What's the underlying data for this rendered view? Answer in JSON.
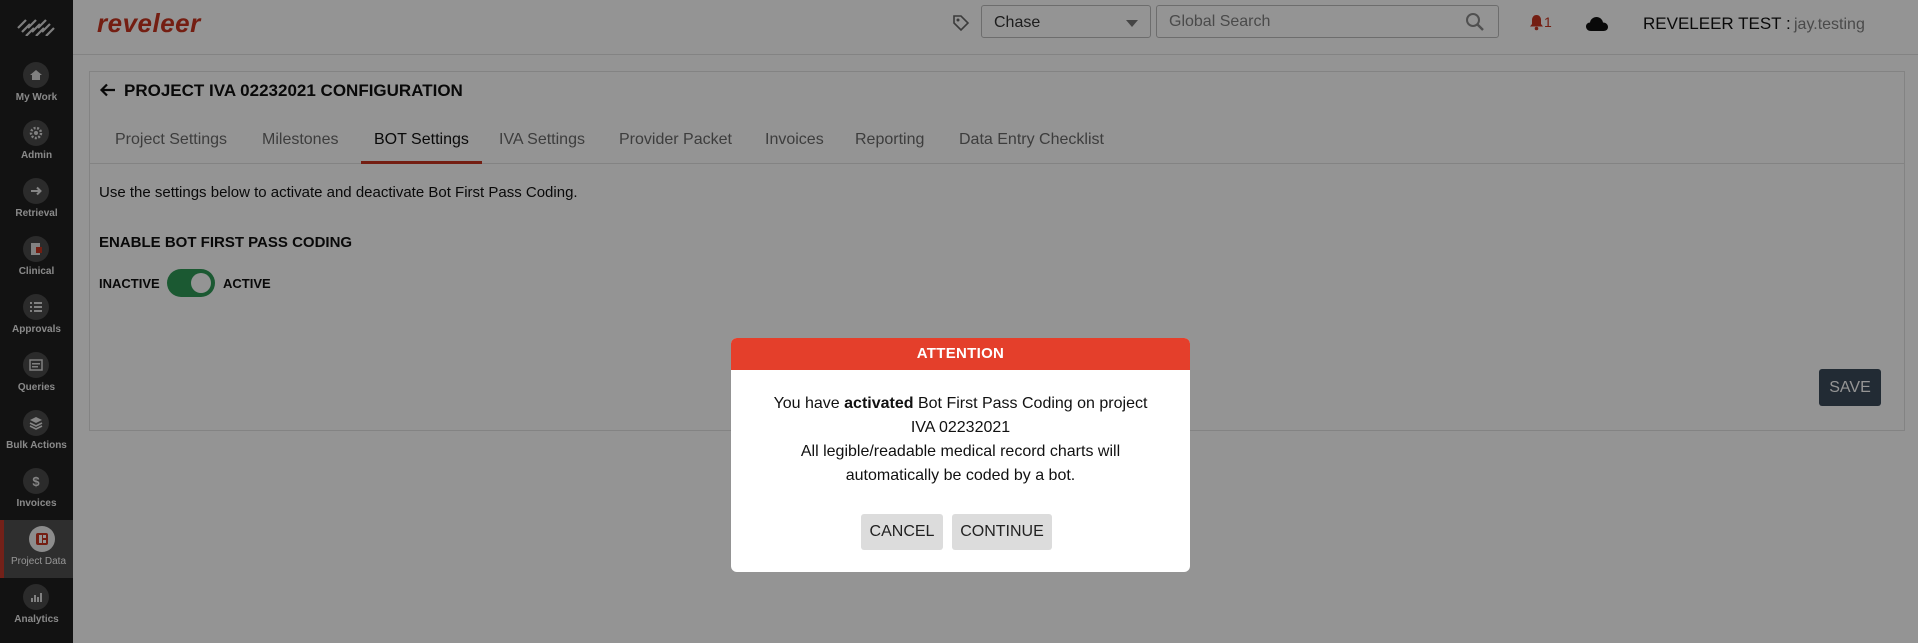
{
  "sidebar": {
    "items": [
      {
        "label": "My Work",
        "icon": "home-icon"
      },
      {
        "label": "Admin",
        "icon": "gear-icon"
      },
      {
        "label": "Retrieval",
        "icon": "arrow-right-icon"
      },
      {
        "label": "Clinical",
        "icon": "document-icon"
      },
      {
        "label": "Approvals",
        "icon": "checklist-icon"
      },
      {
        "label": "Queries",
        "icon": "queries-icon"
      },
      {
        "label": "Bulk Actions",
        "icon": "layers-icon"
      },
      {
        "label": "Invoices",
        "icon": "dollar-icon"
      },
      {
        "label": "Project Data",
        "icon": "project-data-icon",
        "active": true
      },
      {
        "label": "Analytics",
        "icon": "analytics-icon"
      }
    ]
  },
  "topbar": {
    "brand": "reveleer",
    "chase_select": "Chase",
    "search_placeholder": "Global Search",
    "notification_count": "1",
    "user_label": "REVELEER TEST :",
    "user_name": "jay.testing"
  },
  "page": {
    "title": "PROJECT IVA 02232021 CONFIGURATION",
    "tabs": [
      {
        "label": "Project Settings"
      },
      {
        "label": "Milestones"
      },
      {
        "label": "BOT Settings",
        "active": true
      },
      {
        "label": "IVA Settings"
      },
      {
        "label": "Provider Packet"
      },
      {
        "label": "Invoices"
      },
      {
        "label": "Reporting"
      },
      {
        "label": "Data Entry Checklist"
      }
    ],
    "description": "Use the settings below to activate and deactivate Bot First Pass Coding.",
    "section_title": "ENABLE BOT FIRST PASS CODING",
    "toggle_inactive": "INACTIVE",
    "toggle_active": "ACTIVE",
    "toggle_state": "active",
    "save_label": "SAVE"
  },
  "modal": {
    "title": "ATTENTION",
    "line1_prefix": "You have ",
    "line1_bold": "activated",
    "line1_suffix": " Bot First Pass Coding on project",
    "line2": "IVA 02232021",
    "line3": "All legible/readable medical record charts will",
    "line4": "automatically be coded by a bot.",
    "cancel_label": "CANCEL",
    "continue_label": "CONTINUE"
  },
  "colors": {
    "brand": "#c8341f",
    "modal_header": "#e43f2b",
    "toggle_on": "#2f9a56",
    "save_button": "#3b4b5a",
    "sidebar_bg": "#1f1f1f"
  }
}
